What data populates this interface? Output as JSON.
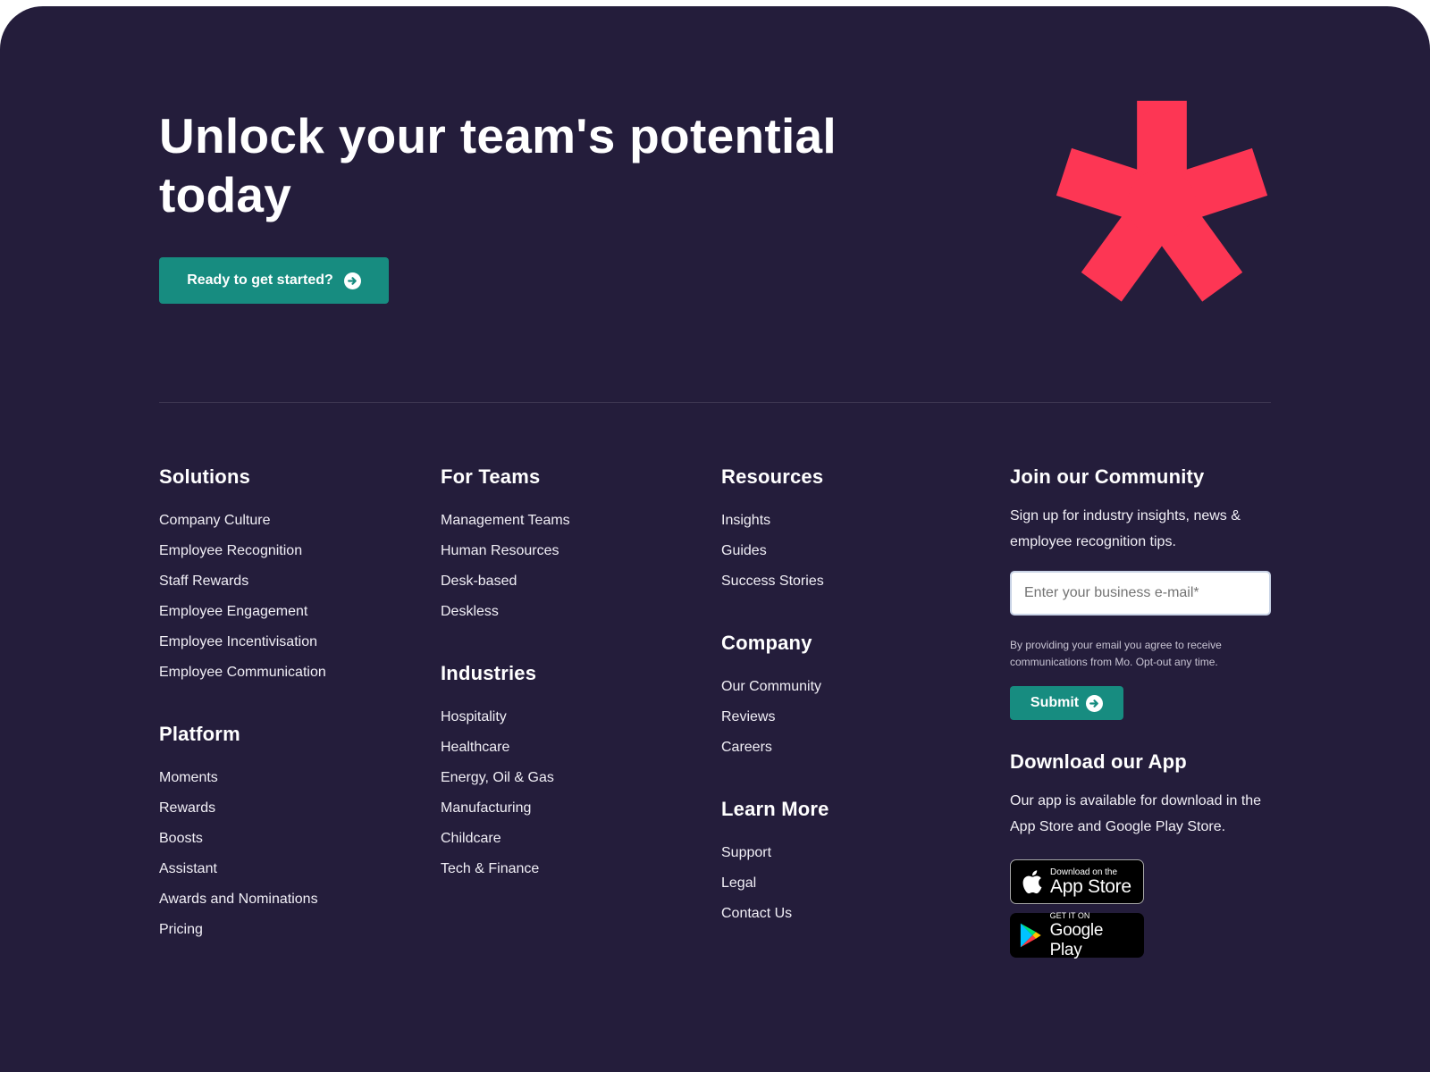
{
  "hero": {
    "title": "Unlock your team's potential today",
    "cta_label": "Ready to get started?"
  },
  "colors": {
    "background": "#241d3b",
    "accent": "#178c80",
    "logo": "#fd3654"
  },
  "columns": [
    {
      "sections": [
        {
          "title": "Solutions",
          "links": [
            "Company Culture",
            "Employee Recognition",
            "Staff Rewards",
            "Employee Engagement",
            "Employee Incentivisation",
            "Employee Communication"
          ]
        },
        {
          "title": "Platform",
          "links": [
            "Moments",
            "Rewards",
            "Boosts",
            "Assistant",
            "Awards and Nominations",
            "Pricing"
          ]
        }
      ]
    },
    {
      "sections": [
        {
          "title": "For Teams",
          "links": [
            "Management Teams",
            "Human Resources",
            "Desk-based",
            "Deskless"
          ]
        },
        {
          "title": "Industries",
          "links": [
            "Hospitality",
            "Healthcare",
            "Energy, Oil & Gas",
            "Manufacturing",
            "Childcare",
            "Tech & Finance"
          ]
        }
      ]
    },
    {
      "sections": [
        {
          "title": "Resources",
          "links": [
            "Insights",
            "Guides",
            "Success Stories"
          ]
        },
        {
          "title": "Company",
          "links": [
            "Our Community",
            "Reviews",
            "Careers"
          ]
        },
        {
          "title": "Learn More",
          "links": [
            "Support",
            "Legal",
            "Contact Us"
          ]
        }
      ]
    }
  ],
  "community": {
    "title": "Join our Community",
    "description": "Sign up for industry insights, news & employee recognition tips.",
    "email_placeholder": "Enter your business e-mail*",
    "email_value": "",
    "legal_note": "By providing your email you agree to receive communications from Mo. Opt-out any time.",
    "submit_label": "Submit"
  },
  "app": {
    "title": "Download our App",
    "description": "Our app is available for download in the App Store and Google Play Store.",
    "app_store": {
      "small": "Download on the",
      "big": "App Store"
    },
    "google_play": {
      "small": "GET IT ON",
      "big": "Google Play"
    }
  }
}
